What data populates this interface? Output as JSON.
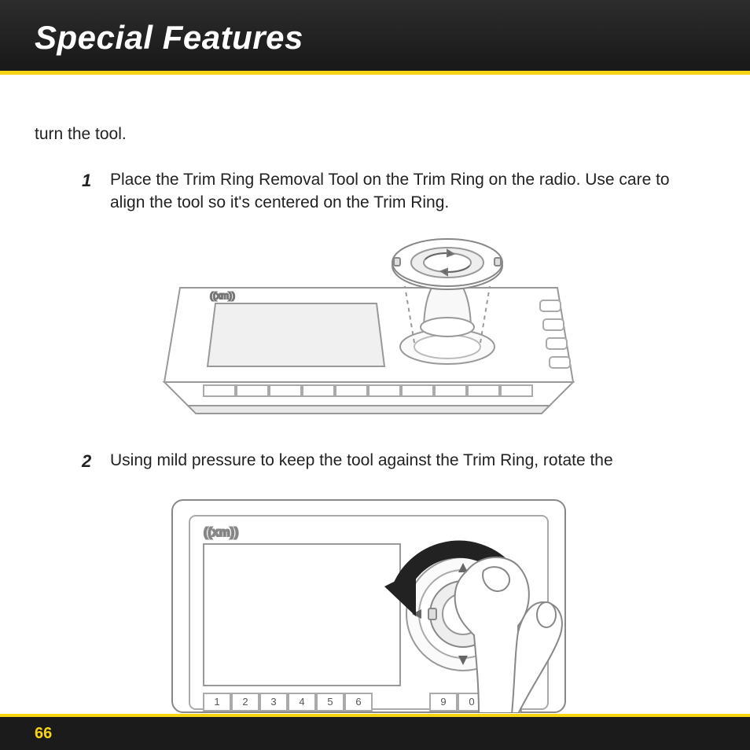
{
  "header": {
    "title": "Special Features"
  },
  "intro_fragment": "turn the tool.",
  "steps": [
    {
      "num": "1",
      "text": "Place the Trim Ring Removal Tool on the Trim Ring on the radio. Use care to align the tool so it's centered on the Trim Ring."
    },
    {
      "num": "2",
      "text": "Using mild pressure to keep the tool against the Trim Ring, rotate the"
    }
  ],
  "figure2_keys": [
    "1",
    "2",
    "3",
    "4",
    "5",
    "6",
    "9",
    "0"
  ],
  "page_number": "66"
}
